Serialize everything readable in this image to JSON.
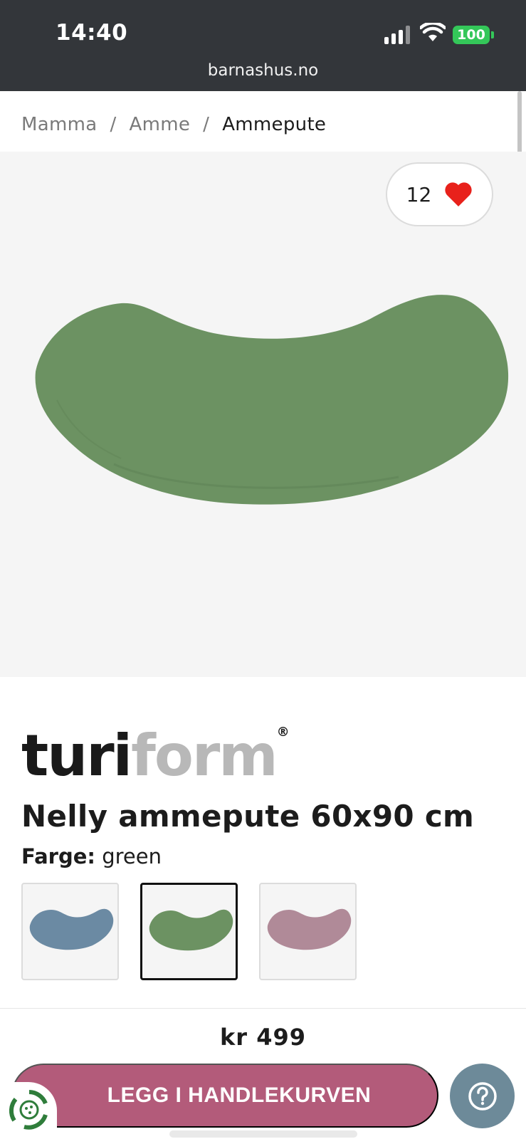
{
  "status_bar": {
    "time": "14:40",
    "battery": "100",
    "url": "barnashus.no"
  },
  "breadcrumb": {
    "items": [
      "Mamma",
      "Amme"
    ],
    "separator": "/",
    "current": "Ammepute"
  },
  "favorite": {
    "count": "12",
    "icon": "heart-icon",
    "color": "#e8211b"
  },
  "product": {
    "brand_part1": "turi",
    "brand_part2": "form",
    "brand_reg": "®",
    "title": "Nelly ammepute 60x90 cm",
    "color_label": "Farge:",
    "color_value": "green",
    "swatches": [
      {
        "color_name": "blue",
        "fill": "#6b8aa3",
        "selected": false
      },
      {
        "color_name": "green",
        "fill": "#6c9262",
        "selected": true
      },
      {
        "color_name": "pink",
        "fill": "#b08a98",
        "selected": false
      }
    ],
    "main_image_color": "#6c9262"
  },
  "purchase": {
    "price": "kr 499",
    "add_to_cart_label": "LEGG I HANDLEKURVEN",
    "button_color": "#b35b7a",
    "help_icon": "question-icon"
  }
}
